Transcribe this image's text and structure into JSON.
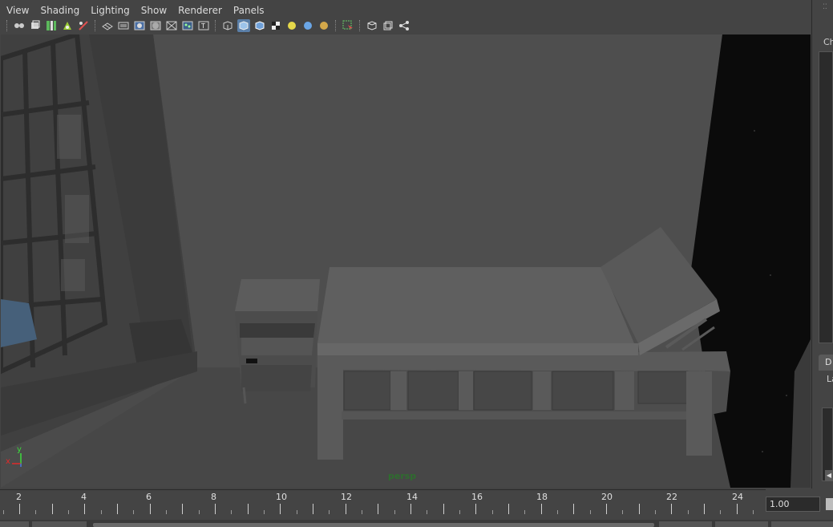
{
  "menubar": {
    "items": [
      "View",
      "Shading",
      "Lighting",
      "Show",
      "Renderer",
      "Panels"
    ]
  },
  "toolbar": {
    "icons": [
      "select-camera-icon",
      "camera-attributes-icon",
      "bookmark-icon",
      "image-plane-icon",
      "grease-pencil-icon",
      "two-d-pan-zoom-icon",
      "grid-icon",
      "film-gate-icon",
      "resolution-gate-icon",
      "gate-mask-icon",
      "field-chart-icon",
      "safe-action-icon",
      "wireframe-icon",
      "smooth-shade-icon",
      "wireframe-on-shaded-icon",
      "textured-icon",
      "use-default-light-icon",
      "shadows-icon",
      "high-quality-icon",
      "isolate-select-icon",
      "xray-icon",
      "xray-joints-icon",
      "xray-components-icon"
    ]
  },
  "viewport": {
    "camera_label": "persp",
    "axis": {
      "x": "x",
      "y": "y"
    }
  },
  "right_panel": {
    "channel_box_label": "Ch",
    "layer_tab_label": "D",
    "layer_label": "La"
  },
  "time_slider": {
    "tick_labels": [
      "2",
      "4",
      "6",
      "8",
      "10",
      "12",
      "14",
      "16",
      "18",
      "20",
      "22",
      "24"
    ],
    "current_time": "1.00"
  },
  "colors": {
    "panel_bg": "#444444",
    "viewport_bg": "#4a4a4a",
    "camera_label": "#2e6d2e",
    "active_button": "#5a7fa8"
  }
}
